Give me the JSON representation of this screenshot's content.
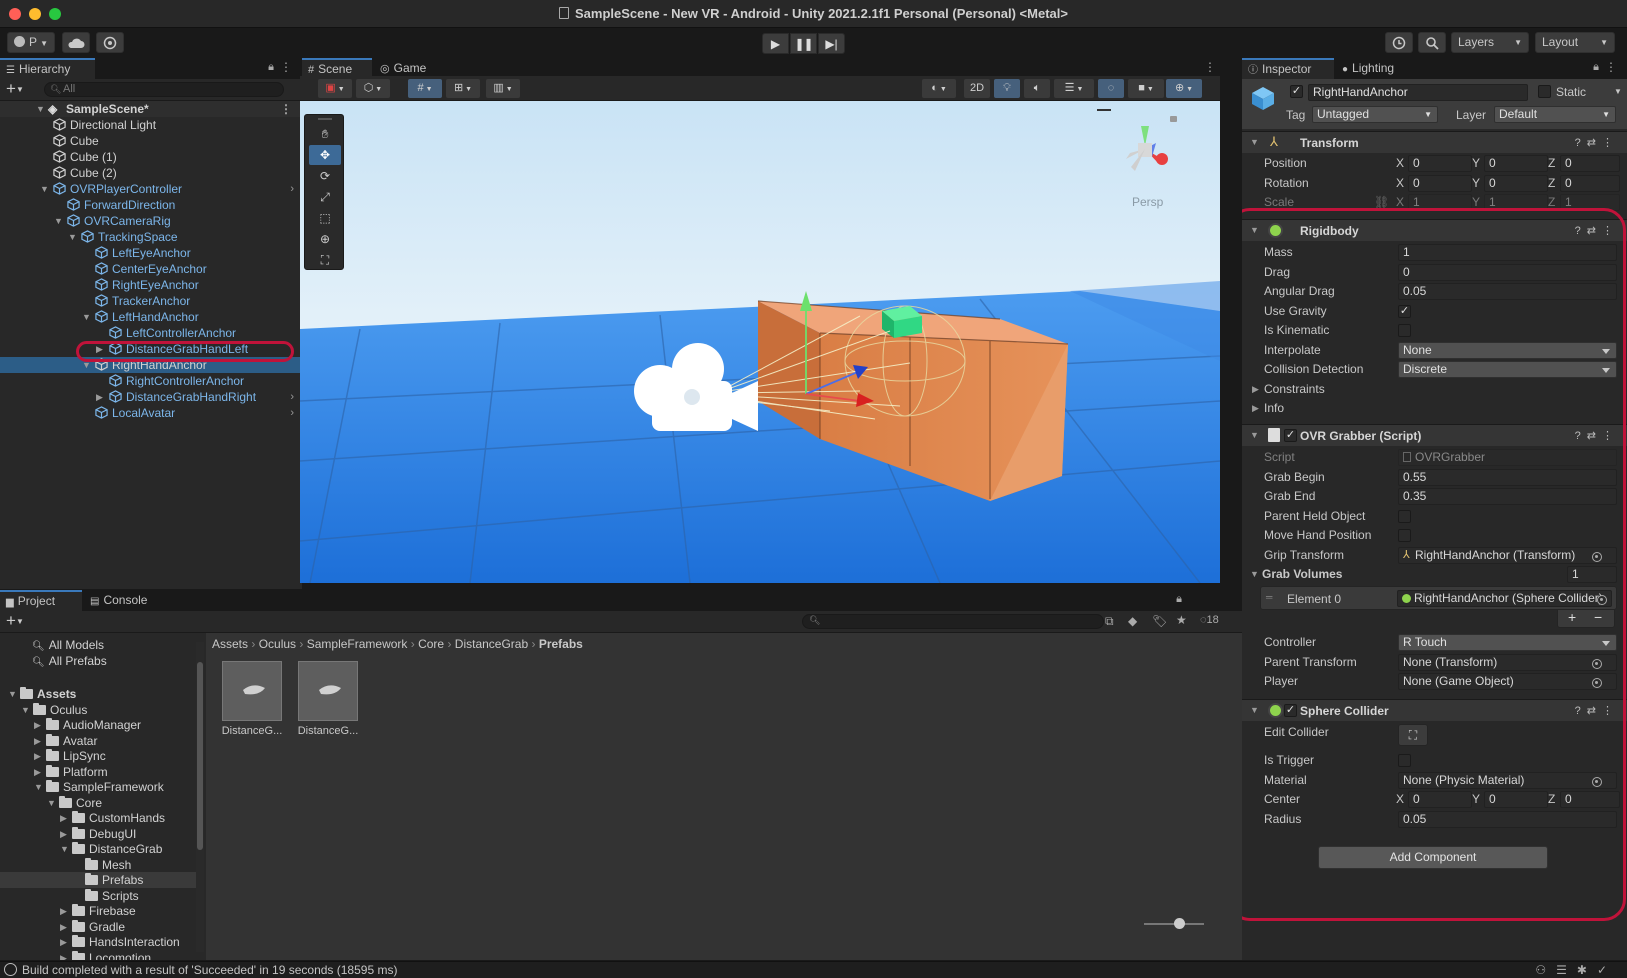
{
  "window": {
    "title": "SampleScene - New VR - Android - Unity 2021.2.1f1 Personal (Personal) <Metal>",
    "colors": {
      "close": "#ff5f57",
      "minimize": "#febc2e",
      "maximize": "#28c840",
      "accent": "#3a79bb",
      "highlight": "#c0133a"
    }
  },
  "toolbar": {
    "account_label": "P",
    "layers_label": "Layers",
    "layout_label": "Layout"
  },
  "hierarchy": {
    "tab": "Hierarchy",
    "search_placeholder": "All",
    "scene": "SampleScene*",
    "items": [
      {
        "label": "Directional Light",
        "depth": 1,
        "blue": false,
        "expand": "",
        "arrow": false
      },
      {
        "label": "Cube",
        "depth": 1,
        "blue": false,
        "expand": "",
        "arrow": false
      },
      {
        "label": "Cube (1)",
        "depth": 1,
        "blue": false,
        "expand": "",
        "arrow": false
      },
      {
        "label": "Cube (2)",
        "depth": 1,
        "blue": false,
        "expand": "",
        "arrow": false
      },
      {
        "label": "OVRPlayerController",
        "depth": 1,
        "blue": true,
        "expand": "open",
        "arrow": true
      },
      {
        "label": "ForwardDirection",
        "depth": 2,
        "blue": true,
        "expand": "",
        "arrow": false
      },
      {
        "label": "OVRCameraRig",
        "depth": 2,
        "blue": true,
        "expand": "open",
        "arrow": false
      },
      {
        "label": "TrackingSpace",
        "depth": 3,
        "blue": true,
        "expand": "open",
        "arrow": false
      },
      {
        "label": "LeftEyeAnchor",
        "depth": 4,
        "blue": true,
        "expand": "",
        "arrow": false
      },
      {
        "label": "CenterEyeAnchor",
        "depth": 4,
        "blue": true,
        "expand": "",
        "arrow": false
      },
      {
        "label": "RightEyeAnchor",
        "depth": 4,
        "blue": true,
        "expand": "",
        "arrow": false
      },
      {
        "label": "TrackerAnchor",
        "depth": 4,
        "blue": true,
        "expand": "",
        "arrow": false
      },
      {
        "label": "LeftHandAnchor",
        "depth": 4,
        "blue": true,
        "expand": "open",
        "arrow": false
      },
      {
        "label": "LeftControllerAnchor",
        "depth": 5,
        "blue": true,
        "expand": "",
        "arrow": false
      },
      {
        "label": "DistanceGrabHandLeft",
        "depth": 5,
        "blue": true,
        "expand": "closed",
        "arrow": true
      },
      {
        "label": "RightHandAnchor",
        "depth": 4,
        "blue": false,
        "expand": "open",
        "arrow": false,
        "selected": true
      },
      {
        "label": "RightControllerAnchor",
        "depth": 5,
        "blue": true,
        "expand": "",
        "arrow": false
      },
      {
        "label": "DistanceGrabHandRight",
        "depth": 5,
        "blue": true,
        "expand": "closed",
        "arrow": true
      },
      {
        "label": "LocalAvatar",
        "depth": 4,
        "blue": true,
        "expand": "",
        "arrow": true
      }
    ]
  },
  "scene": {
    "tabs": [
      "Scene",
      "Game"
    ],
    "mode_2d": "2D",
    "persp": "Persp"
  },
  "project": {
    "tabs": [
      "Project",
      "Console"
    ],
    "count": "18",
    "favorites": [
      "All Models",
      "All Prefabs"
    ],
    "tree": [
      {
        "label": "Assets",
        "depth": 0,
        "expand": "open",
        "bold": true
      },
      {
        "label": "Oculus",
        "depth": 1,
        "expand": "open"
      },
      {
        "label": "AudioManager",
        "depth": 2,
        "expand": "closed"
      },
      {
        "label": "Avatar",
        "depth": 2,
        "expand": "closed"
      },
      {
        "label": "LipSync",
        "depth": 2,
        "expand": "closed"
      },
      {
        "label": "Platform",
        "depth": 2,
        "expand": "closed"
      },
      {
        "label": "SampleFramework",
        "depth": 2,
        "expand": "open"
      },
      {
        "label": "Core",
        "depth": 3,
        "expand": "open"
      },
      {
        "label": "CustomHands",
        "depth": 4,
        "expand": "closed"
      },
      {
        "label": "DebugUI",
        "depth": 4,
        "expand": "closed"
      },
      {
        "label": "DistanceGrab",
        "depth": 4,
        "expand": "open"
      },
      {
        "label": "Mesh",
        "depth": 5,
        "expand": ""
      },
      {
        "label": "Prefabs",
        "depth": 5,
        "expand": "",
        "selected": true
      },
      {
        "label": "Scripts",
        "depth": 5,
        "expand": ""
      },
      {
        "label": "Firebase",
        "depth": 4,
        "expand": "closed"
      },
      {
        "label": "Gradle",
        "depth": 4,
        "expand": "closed"
      },
      {
        "label": "HandsInteraction",
        "depth": 4,
        "expand": "closed"
      },
      {
        "label": "Locomotion",
        "depth": 4,
        "expand": "closed"
      }
    ],
    "breadcrumb": [
      "Assets",
      "Oculus",
      "SampleFramework",
      "Core",
      "DistanceGrab",
      "Prefabs"
    ],
    "assets": [
      "DistanceG...",
      "DistanceG..."
    ]
  },
  "inspector": {
    "tabs": [
      "Inspector",
      "Lighting"
    ],
    "object_name": "RightHandAnchor",
    "static_label": "Static",
    "tag_label": "Tag",
    "tag_value": "Untagged",
    "layer_label": "Layer",
    "layer_value": "Default",
    "transform": {
      "title": "Transform",
      "position_label": "Position",
      "rotation_label": "Rotation",
      "scale_label": "Scale",
      "position": [
        "0",
        "0",
        "0"
      ],
      "rotation": [
        "0",
        "0",
        "0"
      ],
      "scale": [
        "1",
        "1",
        "1"
      ]
    },
    "axis": [
      "X",
      "Y",
      "Z"
    ],
    "rigidbody": {
      "title": "Rigidbody",
      "mass_label": "Mass",
      "mass": "1",
      "drag_label": "Drag",
      "drag": "0",
      "angular_drag_label": "Angular Drag",
      "angular_drag": "0.05",
      "use_gravity_label": "Use Gravity",
      "is_kinematic_label": "Is Kinematic",
      "interpolate_label": "Interpolate",
      "interpolate": "None",
      "collision_label": "Collision Detection",
      "collision": "Discrete",
      "constraints_label": "Constraints",
      "info_label": "Info"
    },
    "grabber": {
      "title": "OVR Grabber (Script)",
      "script_label": "Script",
      "script": "OVRGrabber",
      "grab_begin_label": "Grab Begin",
      "grab_begin": "0.55",
      "grab_end_label": "Grab End",
      "grab_end": "0.35",
      "parent_held_label": "Parent Held Object",
      "move_hand_label": "Move Hand Position",
      "grip_label": "Grip Transform",
      "grip": "RightHandAnchor (Transform)",
      "volumes_label": "Grab Volumes",
      "volumes_count": "1",
      "element_label": "Element 0",
      "element": "RightHandAnchor (Sphere Collider)",
      "controller_label": "Controller",
      "controller": "R Touch",
      "parent_transform_label": "Parent Transform",
      "parent_transform": "None (Transform)",
      "player_label": "Player",
      "player": "None (Game Object)"
    },
    "sphere": {
      "title": "Sphere Collider",
      "edit_label": "Edit Collider",
      "trigger_label": "Is Trigger",
      "material_label": "Material",
      "material": "None (Physic Material)",
      "center_label": "Center",
      "center": [
        "0",
        "0",
        "0"
      ],
      "radius_label": "Radius",
      "radius": "0.05"
    },
    "add_component": "Add Component"
  },
  "status": {
    "message": "Build completed with a result of 'Succeeded' in 19 seconds (18595 ms)"
  }
}
